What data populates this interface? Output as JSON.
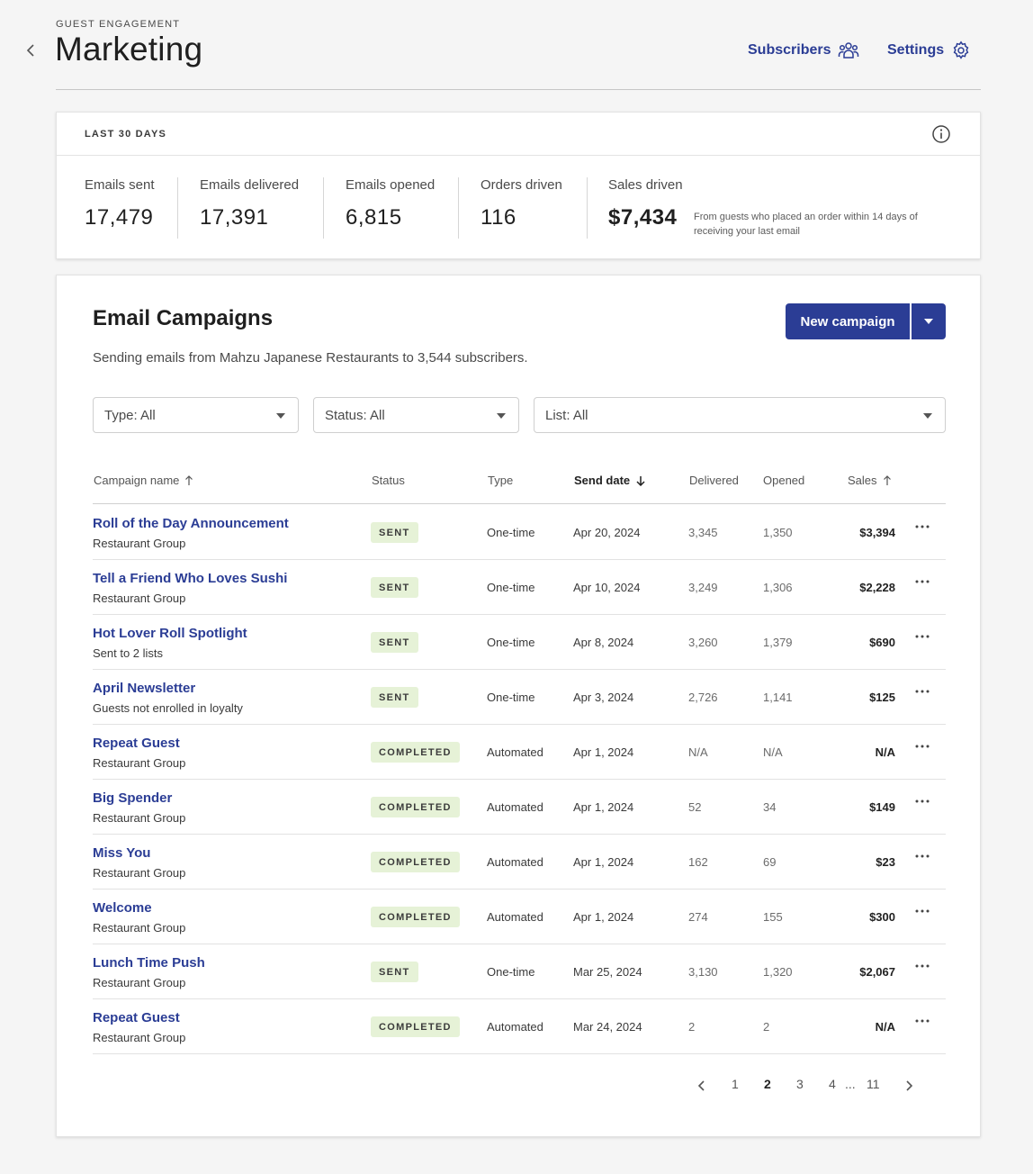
{
  "header": {
    "eyebrow": "GUEST ENGAGEMENT",
    "title": "Marketing",
    "subscribers_label": "Subscribers",
    "settings_label": "Settings"
  },
  "stats": {
    "period_label": "LAST 30 DAYS",
    "items": [
      {
        "label": "Emails sent",
        "value": "17,479"
      },
      {
        "label": "Emails delivered",
        "value": "17,391"
      },
      {
        "label": "Emails opened",
        "value": "6,815"
      },
      {
        "label": "Orders driven",
        "value": "116"
      },
      {
        "label": "Sales driven",
        "value": "$7,434"
      }
    ],
    "sales_note": "From guests who placed an order within 14 days of receiving your last email"
  },
  "campaigns": {
    "title": "Email Campaigns",
    "subtitle": "Sending emails from Mahzu Japanese Restaurants to 3,544 subscribers.",
    "new_button": "New campaign",
    "filters": {
      "type": "Type: All",
      "status": "Status: All",
      "list": "List: All"
    },
    "columns": {
      "name": "Campaign name",
      "status": "Status",
      "type": "Type",
      "date": "Send date",
      "delivered": "Delivered",
      "opened": "Opened",
      "sales": "Sales"
    },
    "rows": [
      {
        "name": "Roll of the Day Announcement",
        "sub": "Restaurant Group",
        "status": "SENT",
        "type": "One-time",
        "date": "Apr 20, 2024",
        "delivered": "3,345",
        "opened": "1,350",
        "sales": "$3,394"
      },
      {
        "name": "Tell a Friend Who Loves Sushi",
        "sub": "Restaurant Group",
        "status": "SENT",
        "type": "One-time",
        "date": "Apr 10, 2024",
        "delivered": "3,249",
        "opened": "1,306",
        "sales": "$2,228"
      },
      {
        "name": "Hot Lover Roll Spotlight",
        "sub": "Sent to 2 lists",
        "status": "SENT",
        "type": "One-time",
        "date": "Apr 8, 2024",
        "delivered": "3,260",
        "opened": "1,379",
        "sales": "$690"
      },
      {
        "name": "April Newsletter",
        "sub": "Guests not enrolled in loyalty",
        "status": "SENT",
        "type": "One-time",
        "date": "Apr 3, 2024",
        "delivered": "2,726",
        "opened": "1,141",
        "sales": "$125"
      },
      {
        "name": "Repeat Guest",
        "sub": "Restaurant Group",
        "status": "COMPLETED",
        "type": "Automated",
        "date": "Apr 1, 2024",
        "delivered": "N/A",
        "opened": "N/A",
        "sales": "N/A"
      },
      {
        "name": "Big Spender",
        "sub": "Restaurant Group",
        "status": "COMPLETED",
        "type": "Automated",
        "date": "Apr 1, 2024",
        "delivered": "52",
        "opened": "34",
        "sales": "$149"
      },
      {
        "name": "Miss You",
        "sub": "Restaurant Group",
        "status": "COMPLETED",
        "type": "Automated",
        "date": "Apr 1, 2024",
        "delivered": "162",
        "opened": "69",
        "sales": "$23"
      },
      {
        "name": "Welcome",
        "sub": "Restaurant Group",
        "status": "COMPLETED",
        "type": "Automated",
        "date": "Apr 1, 2024",
        "delivered": "274",
        "opened": "155",
        "sales": "$300"
      },
      {
        "name": "Lunch Time Push",
        "sub": "Restaurant Group",
        "status": "SENT",
        "type": "One-time",
        "date": "Mar 25, 2024",
        "delivered": "3,130",
        "opened": "1,320",
        "sales": "$2,067"
      },
      {
        "name": "Repeat Guest",
        "sub": "Restaurant Group",
        "status": "COMPLETED",
        "type": "Automated",
        "date": "Mar 24, 2024",
        "delivered": "2",
        "opened": "2",
        "sales": "N/A"
      }
    ]
  },
  "pagination": {
    "pages": [
      "1",
      "2",
      "3",
      "4"
    ],
    "ellipsis": "...",
    "last": "11",
    "current": "2"
  },
  "colors": {
    "accent": "#2b3d95",
    "badge_bg": "#e6f2d7",
    "background": "#f5f5f5"
  },
  "icons": {
    "back": "chevron-left-icon",
    "subscribers": "people-group-icon",
    "settings": "gear-icon",
    "info": "info-icon",
    "dropdown": "caret-down-icon",
    "more": "more-horizontal-icon"
  }
}
